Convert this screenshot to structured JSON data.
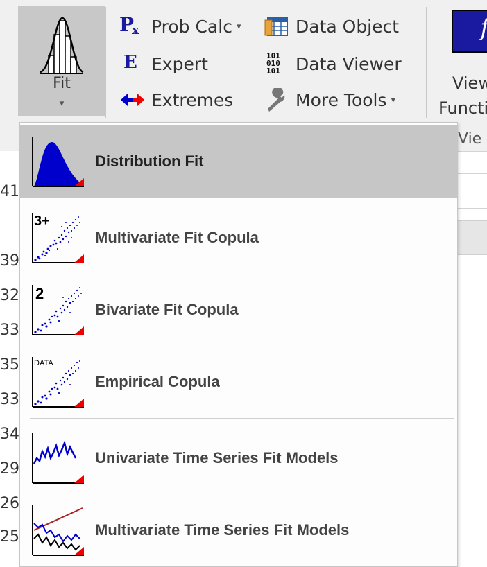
{
  "ribbon": {
    "fit_button": {
      "label": "Fit",
      "caret": "▾"
    },
    "items": {
      "prob_calc": {
        "label": "Prob Calc",
        "caret": "▾"
      },
      "expert": {
        "label": "Expert"
      },
      "extremes": {
        "label": "Extremes"
      },
      "data_object": {
        "label": "Data Object"
      },
      "data_viewer": {
        "label": "Data Viewer"
      },
      "more_tools": {
        "label": "More Tools",
        "caret": "▾"
      }
    },
    "view_function": {
      "line1": "View",
      "line2": "Functi",
      "icon_glyph": "f",
      "group_label": "Vie"
    }
  },
  "sheet": {
    "row_numbers": [
      "41",
      "39",
      "32",
      "33",
      "35",
      "33",
      "34",
      "29",
      "26",
      "25"
    ]
  },
  "menu": {
    "items": [
      {
        "label": "Distribution Fit",
        "icon": "distribution-fit-icon",
        "active": true
      },
      {
        "label": "Multivariate Fit Copula",
        "icon": "multivariate-copula-icon",
        "badge": "3+"
      },
      {
        "label": "Bivariate Fit Copula",
        "icon": "bivariate-copula-icon",
        "badge": "2"
      },
      {
        "label": "Empirical Copula",
        "icon": "empirical-copula-icon",
        "badge": "DATA"
      },
      {
        "label": "Univariate Time Series Fit Models",
        "icon": "univariate-time-series-icon"
      },
      {
        "label": "Multivariate Time Series Fit Models",
        "icon": "multivariate-time-series-icon"
      }
    ]
  },
  "colors": {
    "ribbon_bg": "#f0f0f0",
    "fit_active_bg": "#c8c8c8",
    "menu_active_bg": "#c6c6c6",
    "icon_blue": "#0000cc",
    "icon_red": "#ee0000"
  }
}
